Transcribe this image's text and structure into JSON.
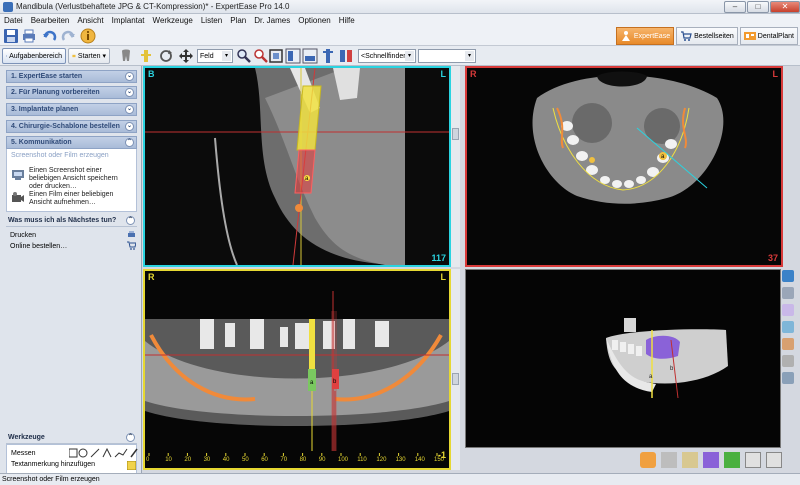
{
  "window": {
    "title": "Mandibula (Verlustbehaftete JPG & CT-Kompression)* - ExpertEase Pro  14.0",
    "minimize": "–",
    "maximize": "□",
    "close": "✕"
  },
  "menu": [
    "Datei",
    "Bearbeiten",
    "Ansicht",
    "Implantat",
    "Werkzeuge",
    "Listen",
    "Plan",
    "Dr. James",
    "Optionen",
    "Hilfe"
  ],
  "app_tabs": [
    {
      "label": "ExpertEase",
      "active": true
    },
    {
      "label": "Bestellseiten",
      "active": false
    },
    {
      "label": "DentalPlant",
      "active": false
    }
  ],
  "toolbar2": {
    "task_area": "Aufgabenbereich",
    "start": "Starten",
    "mode_select": "Feld",
    "quickfinder": "<Schnellfinder>",
    "dropdown_arrow": "▾"
  },
  "steps": [
    {
      "label": "1. ExpertEase starten"
    },
    {
      "label": "2. Für Planung vorbereiten"
    },
    {
      "label": "3. Implantate planen"
    },
    {
      "label": "4. Chirurgie-Schablone bestellen"
    },
    {
      "label": "5. Kommunikation"
    }
  ],
  "chevron_up": "⌃",
  "chevron_down": "⌄",
  "communication": {
    "sub_header": "Screenshot oder Film erzeugen",
    "actions": [
      {
        "label": "Einen Screenshot einer beliebigen Ansicht speichern oder drucken…"
      },
      {
        "label": "Einen Film einer beliebigen Ansicht aufnehmen…"
      }
    ]
  },
  "next_steps": {
    "title": "Was muss ich als Nächstes tun?",
    "items": [
      {
        "label": "Drucken"
      },
      {
        "label": "Online bestellen…"
      }
    ]
  },
  "tools": {
    "title": "Werkzeuge",
    "measure": "Messen",
    "text_note": "Textanmerkung hinzufügen"
  },
  "viewports": {
    "sagittal": {
      "left_label": "B",
      "right_label": "L",
      "slice": "117"
    },
    "axial": {
      "left_label": "R",
      "right_label": "L",
      "slice": "37"
    },
    "panoramic": {
      "left_label": "R",
      "right_label": "L",
      "slice": "-1",
      "scale": [
        0,
        10,
        20,
        30,
        40,
        50,
        60,
        70,
        80,
        90,
        100,
        110,
        120,
        130,
        140,
        150
      ]
    }
  },
  "implant_labels": {
    "a": "a",
    "b": "b"
  },
  "colors": {
    "sagittal_border": "#2ad3e0",
    "axial_border": "#d83a3a",
    "panoramic_border": "#e6d832",
    "implant_yellow": "#f0e040",
    "implant_red": "#e04040",
    "nerve_orange": "#f08a3a"
  },
  "status": "Screenshot oder Film erzeugen"
}
